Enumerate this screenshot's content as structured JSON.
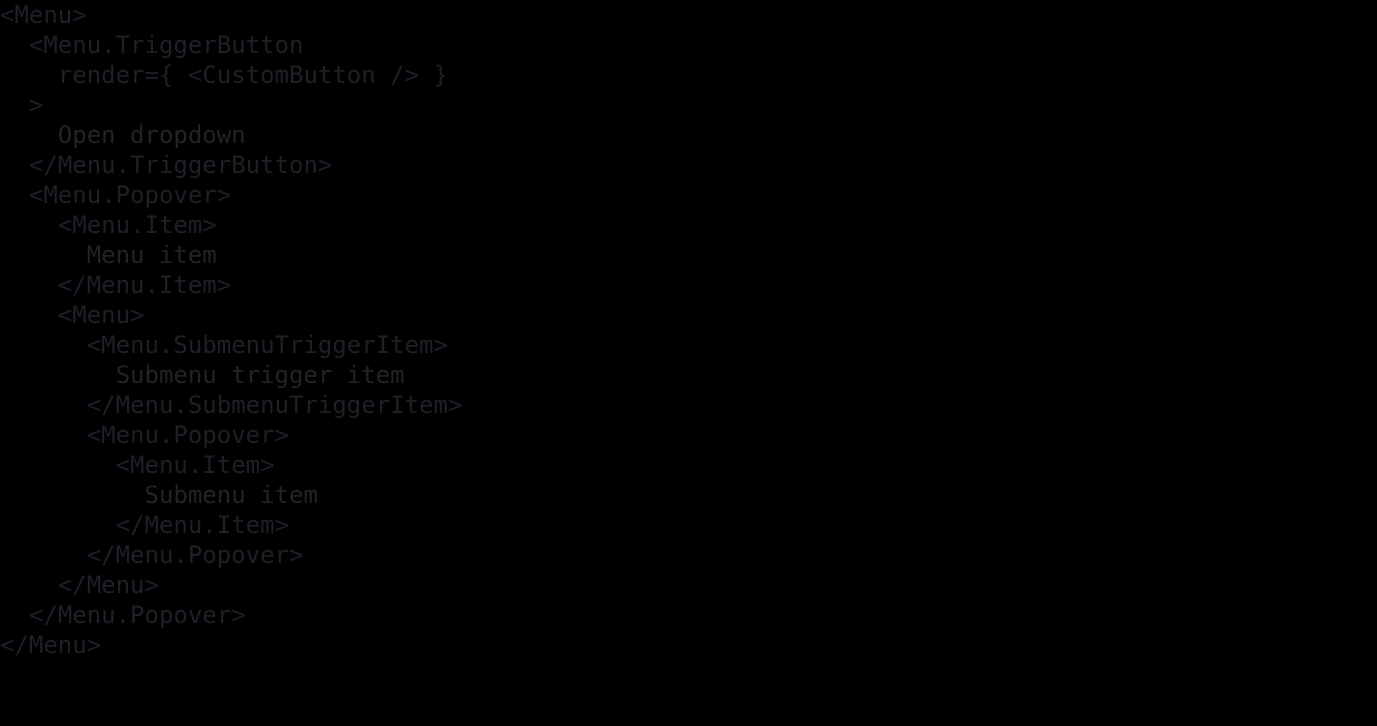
{
  "code_block": {
    "language": "jsx",
    "background_color": "#000000",
    "colors": {
      "punctuation": "#1b1f2a",
      "tag": "#1d2026",
      "attribute": "#1e2128",
      "text": "#212328"
    },
    "lines": [
      {
        "indent": 0,
        "tokens": [
          {
            "t": "punct",
            "s": "<"
          },
          {
            "t": "tag",
            "s": "Menu"
          },
          {
            "t": "punct",
            "s": ">"
          }
        ]
      },
      {
        "indent": 1,
        "tokens": [
          {
            "t": "punct",
            "s": "<"
          },
          {
            "t": "tag",
            "s": "Menu.TriggerButton"
          }
        ]
      },
      {
        "indent": 2,
        "tokens": [
          {
            "t": "attr",
            "s": "render"
          },
          {
            "t": "punct",
            "s": "={ <"
          },
          {
            "t": "tag",
            "s": "CustomButton"
          },
          {
            "t": "punct",
            "s": " /> }"
          }
        ]
      },
      {
        "indent": 1,
        "tokens": [
          {
            "t": "punct",
            "s": ">"
          }
        ]
      },
      {
        "indent": 2,
        "tokens": [
          {
            "t": "txt",
            "s": "Open dropdown"
          }
        ]
      },
      {
        "indent": 1,
        "tokens": [
          {
            "t": "punct",
            "s": "</"
          },
          {
            "t": "tag",
            "s": "Menu.TriggerButton"
          },
          {
            "t": "punct",
            "s": ">"
          }
        ]
      },
      {
        "indent": 1,
        "tokens": [
          {
            "t": "punct",
            "s": "<"
          },
          {
            "t": "tag",
            "s": "Menu.Popover"
          },
          {
            "t": "punct",
            "s": ">"
          }
        ]
      },
      {
        "indent": 2,
        "tokens": [
          {
            "t": "punct",
            "s": "<"
          },
          {
            "t": "tag",
            "s": "Menu.Item"
          },
          {
            "t": "punct",
            "s": ">"
          }
        ]
      },
      {
        "indent": 3,
        "tokens": [
          {
            "t": "txt",
            "s": "Menu item"
          }
        ]
      },
      {
        "indent": 2,
        "tokens": [
          {
            "t": "punct",
            "s": "</"
          },
          {
            "t": "tag",
            "s": "Menu.Item"
          },
          {
            "t": "punct",
            "s": ">"
          }
        ]
      },
      {
        "indent": 2,
        "tokens": [
          {
            "t": "punct",
            "s": "<"
          },
          {
            "t": "tag",
            "s": "Menu"
          },
          {
            "t": "punct",
            "s": ">"
          }
        ]
      },
      {
        "indent": 3,
        "tokens": [
          {
            "t": "punct",
            "s": "<"
          },
          {
            "t": "tag",
            "s": "Menu.SubmenuTriggerItem"
          },
          {
            "t": "punct",
            "s": ">"
          }
        ]
      },
      {
        "indent": 4,
        "tokens": [
          {
            "t": "txt",
            "s": "Submenu trigger item"
          }
        ]
      },
      {
        "indent": 3,
        "tokens": [
          {
            "t": "punct",
            "s": "</"
          },
          {
            "t": "tag",
            "s": "Menu.SubmenuTriggerItem"
          },
          {
            "t": "punct",
            "s": ">"
          }
        ]
      },
      {
        "indent": 3,
        "tokens": [
          {
            "t": "punct",
            "s": "<"
          },
          {
            "t": "tag",
            "s": "Menu.Popover"
          },
          {
            "t": "punct",
            "s": ">"
          }
        ]
      },
      {
        "indent": 4,
        "tokens": [
          {
            "t": "punct",
            "s": "<"
          },
          {
            "t": "tag",
            "s": "Menu.Item"
          },
          {
            "t": "punct",
            "s": ">"
          }
        ]
      },
      {
        "indent": 5,
        "tokens": [
          {
            "t": "txt",
            "s": "Submenu item"
          }
        ]
      },
      {
        "indent": 4,
        "tokens": [
          {
            "t": "punct",
            "s": "</"
          },
          {
            "t": "tag",
            "s": "Menu.Item"
          },
          {
            "t": "punct",
            "s": ">"
          }
        ]
      },
      {
        "indent": 3,
        "tokens": [
          {
            "t": "punct",
            "s": "</"
          },
          {
            "t": "tag",
            "s": "Menu.Popover"
          },
          {
            "t": "punct",
            "s": ">"
          }
        ]
      },
      {
        "indent": 2,
        "tokens": [
          {
            "t": "punct",
            "s": "</"
          },
          {
            "t": "tag",
            "s": "Menu"
          },
          {
            "t": "punct",
            "s": ">"
          }
        ]
      },
      {
        "indent": 1,
        "tokens": [
          {
            "t": "punct",
            "s": "</"
          },
          {
            "t": "tag",
            "s": "Menu.Popover"
          },
          {
            "t": "punct",
            "s": ">"
          }
        ]
      },
      {
        "indent": 0,
        "tokens": [
          {
            "t": "punct",
            "s": "</"
          },
          {
            "t": "tag",
            "s": "Menu"
          },
          {
            "t": "punct",
            "s": ">"
          }
        ]
      }
    ],
    "plain_text": "<Menu>\n  <Menu.TriggerButton\n    render={ <CustomButton /> }\n  >\n    Open dropdown\n  </Menu.TriggerButton>\n  <Menu.Popover>\n    <Menu.Item>\n      Menu item\n    </Menu.Item>\n    <Menu>\n      <Menu.SubmenuTriggerItem>\n        Submenu trigger item\n      </Menu.SubmenuTriggerItem>\n      <Menu.Popover>\n        <Menu.Item>\n          Submenu item\n        </Menu.Item>\n      </Menu.Popover>\n    </Menu>\n  </Menu.Popover>\n</Menu>"
  }
}
